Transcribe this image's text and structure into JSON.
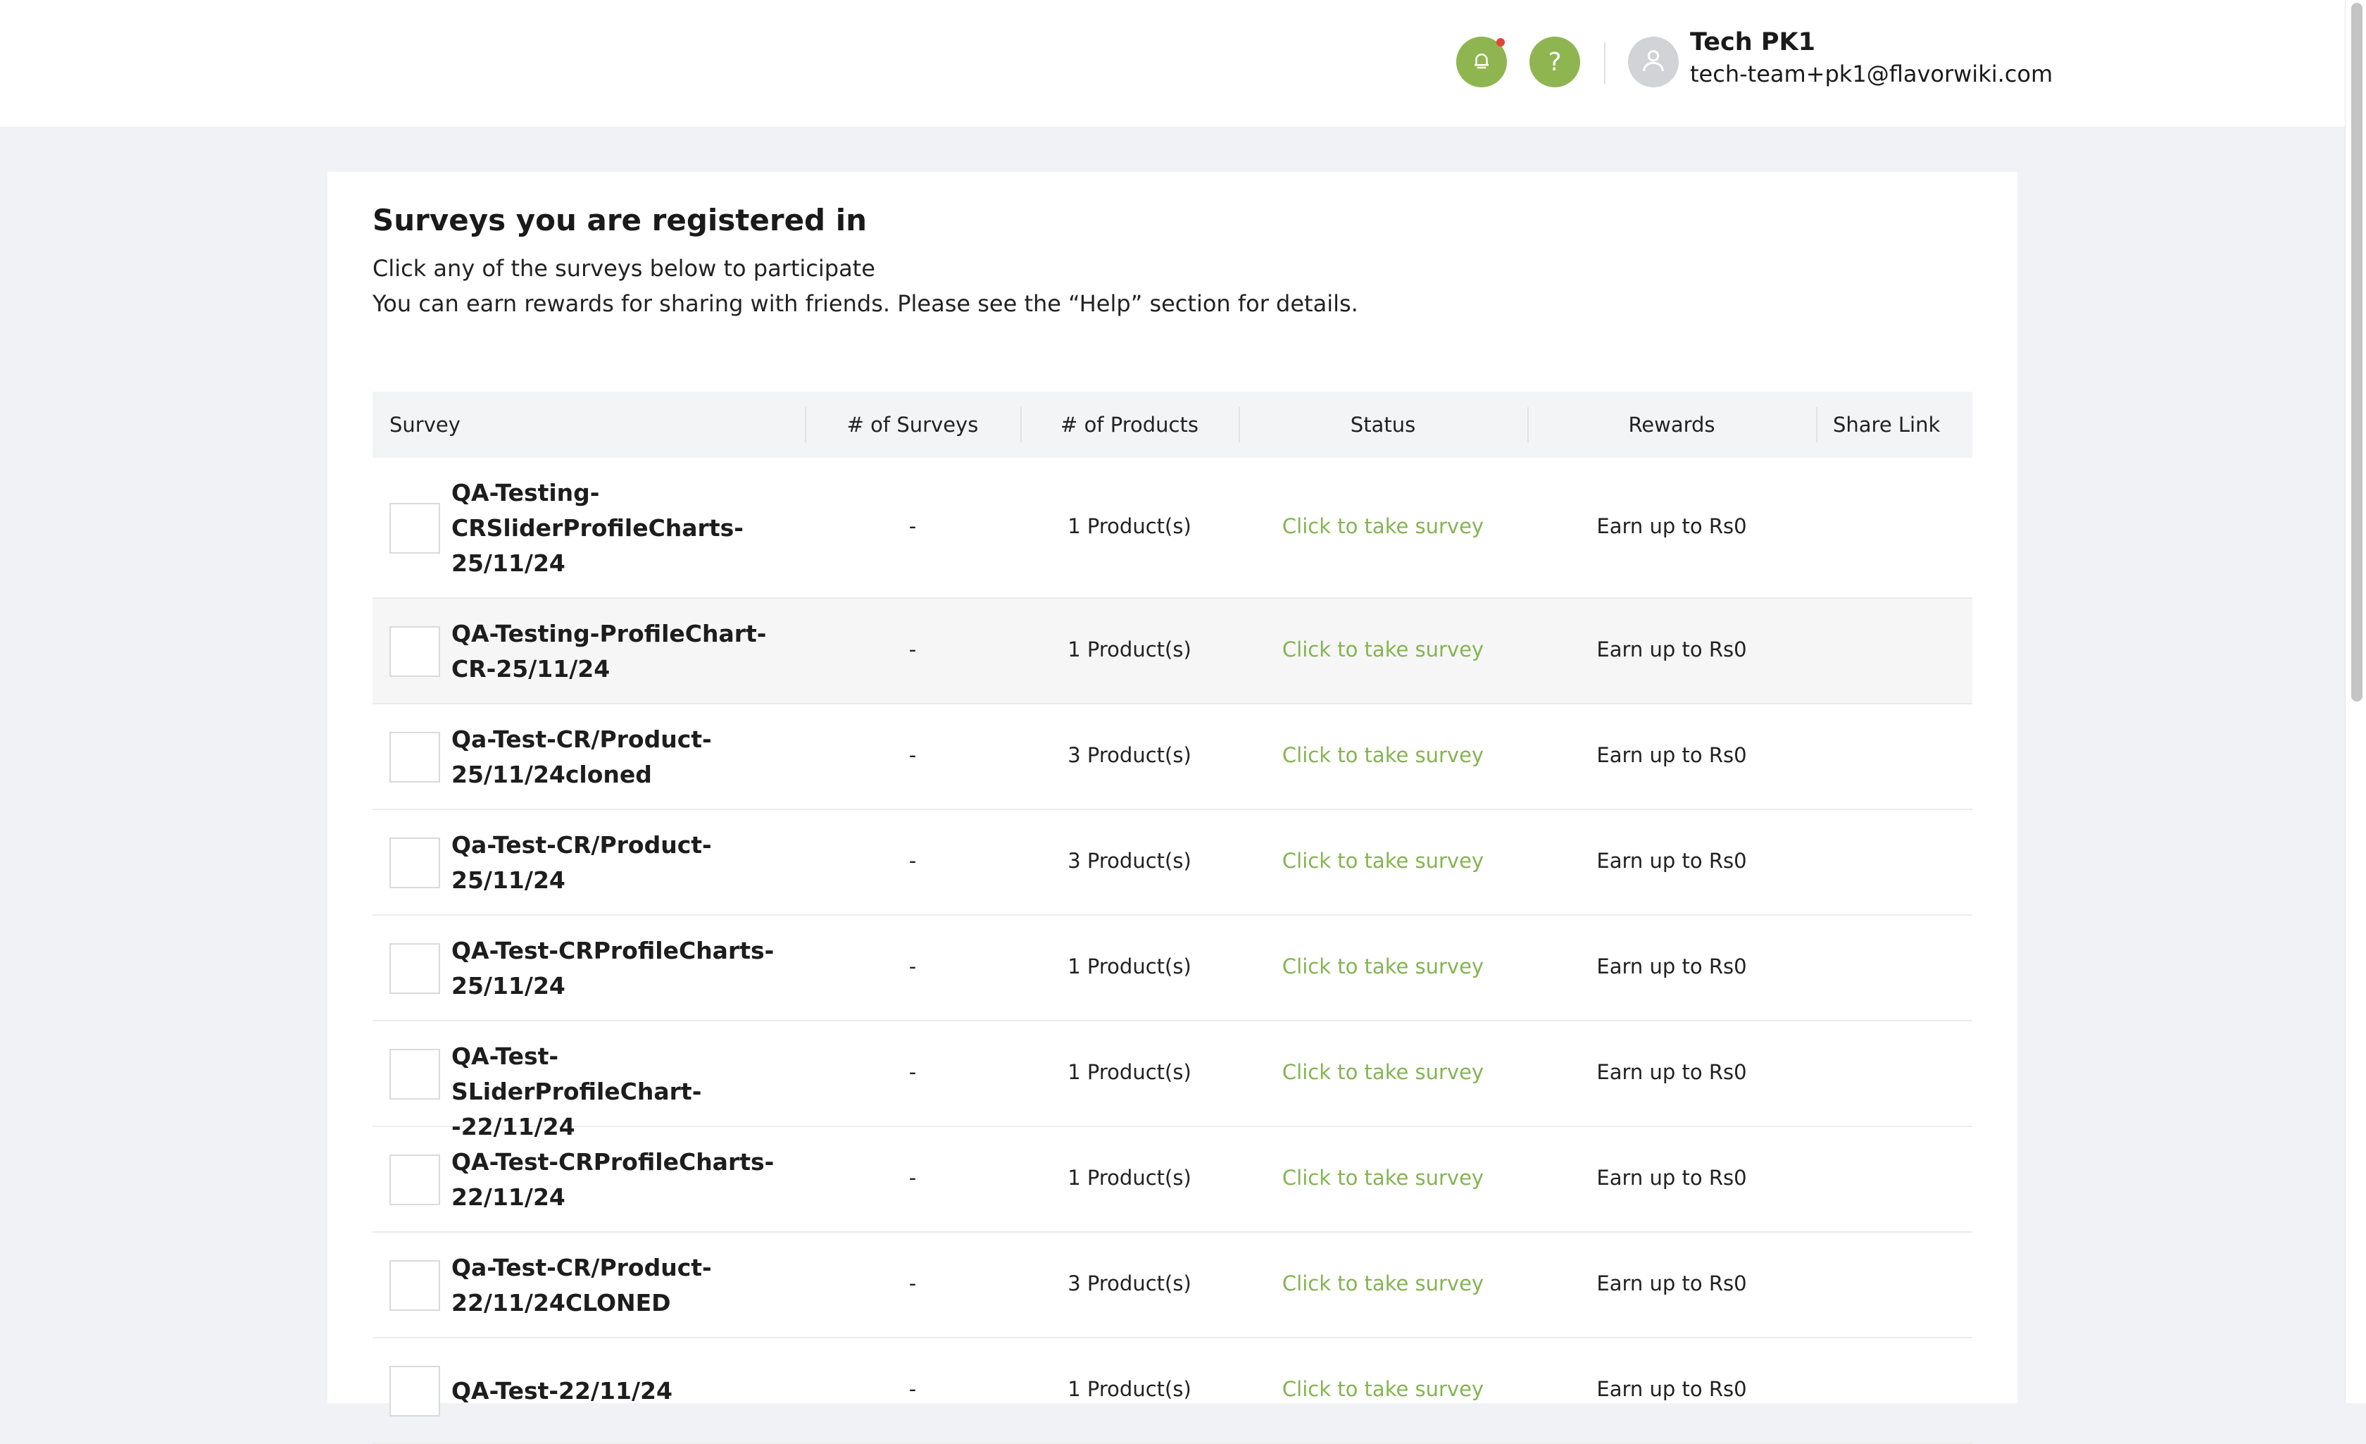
{
  "header": {
    "notification_icon": "bell-icon",
    "help_icon": "question-icon",
    "help_glyph": "?",
    "user": {
      "name": "Tech PK1",
      "email": "tech-team+pk1@flavorwiki.com"
    },
    "accent_color": "#8fb551"
  },
  "page": {
    "title": "Surveys you are registered in",
    "subtitle_1": "Click any of the surveys below to participate",
    "subtitle_2": "You can earn rewards for sharing with friends. Please see the “Help” section for details."
  },
  "table": {
    "columns": {
      "survey": "Survey",
      "num_surveys": "# of Surveys",
      "num_products": "# of Products",
      "status": "Status",
      "rewards": "Rewards",
      "share_link": "Share Link"
    },
    "rows": [
      {
        "name": "QA-Testing-\nCRSliderProfileCharts-\n25/11/24",
        "surveys": "-",
        "products": "1 Product(s)",
        "status": "Click to take survey",
        "rewards": "Earn up to Rs0"
      },
      {
        "name": "QA-Testing-ProfileChart-\nCR-25/11/24",
        "surveys": "-",
        "products": "1 Product(s)",
        "status": "Click to take survey",
        "rewards": "Earn up to Rs0"
      },
      {
        "name": "Qa-Test-CR/Product-\n25/11/24cloned",
        "surveys": "-",
        "products": "3 Product(s)",
        "status": "Click to take survey",
        "rewards": "Earn up to Rs0"
      },
      {
        "name": "Qa-Test-CR/Product-\n25/11/24",
        "surveys": "-",
        "products": "3 Product(s)",
        "status": "Click to take survey",
        "rewards": "Earn up to Rs0"
      },
      {
        "name": "QA-Test-CRProfileCharts-\n25/11/24",
        "surveys": "-",
        "products": "1 Product(s)",
        "status": "Click to take survey",
        "rewards": "Earn up to Rs0"
      },
      {
        "name": "QA-Test-SLiderProfileChart-\n-22/11/24",
        "surveys": "-",
        "products": "1 Product(s)",
        "status": "Click to take survey",
        "rewards": "Earn up to Rs0"
      },
      {
        "name": "QA-Test-CRProfileCharts-\n22/11/24",
        "surveys": "-",
        "products": "1 Product(s)",
        "status": "Click to take survey",
        "rewards": "Earn up to Rs0"
      },
      {
        "name": "Qa-Test-CR/Product-\n22/11/24CLONED",
        "surveys": "-",
        "products": "3 Product(s)",
        "status": "Click to take survey",
        "rewards": "Earn up to Rs0"
      },
      {
        "name": "QA-Test-22/11/24",
        "surveys": "-",
        "products": "1 Product(s)",
        "status": "Click to take survey",
        "rewards": "Earn up to Rs0"
      }
    ]
  }
}
